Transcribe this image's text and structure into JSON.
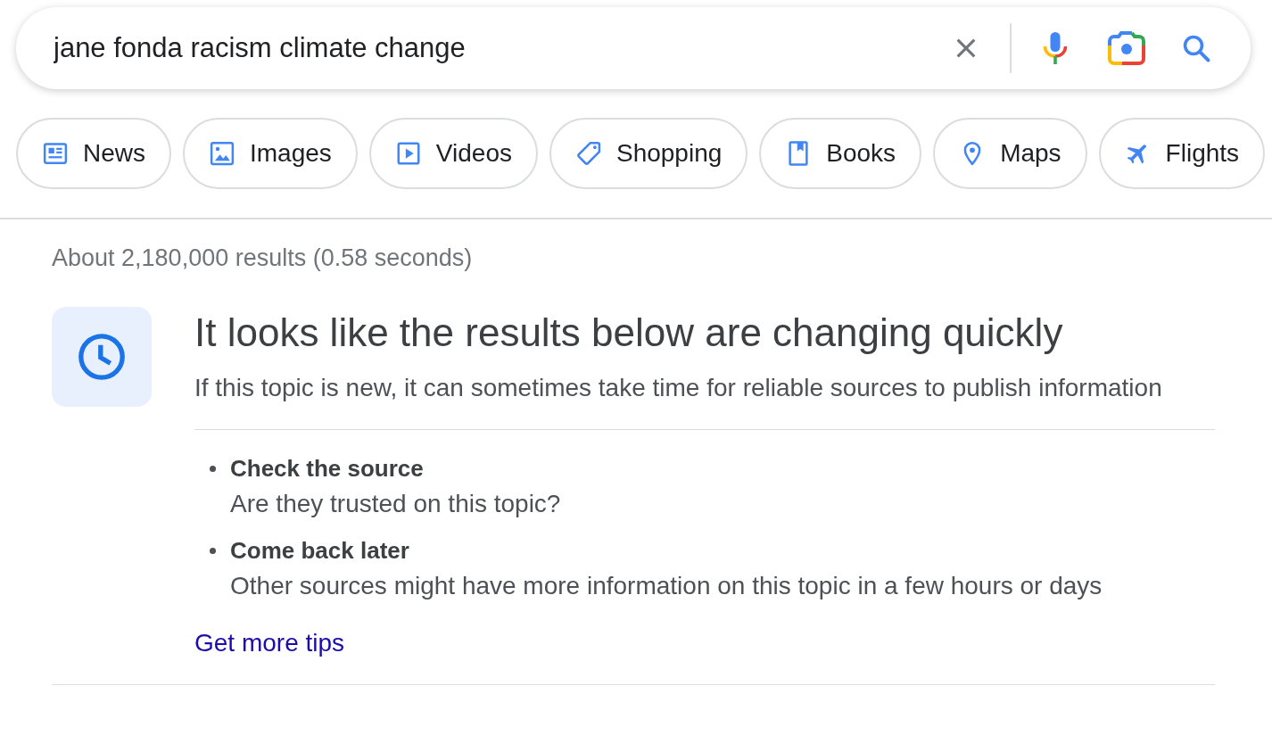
{
  "search": {
    "query": "jane fonda racism climate change"
  },
  "chips": [
    {
      "label": "News",
      "kind": "news"
    },
    {
      "label": "Images",
      "kind": "images"
    },
    {
      "label": "Videos",
      "kind": "videos"
    },
    {
      "label": "Shopping",
      "kind": "shopping"
    },
    {
      "label": "Books",
      "kind": "books"
    },
    {
      "label": "Maps",
      "kind": "maps"
    },
    {
      "label": "Flights",
      "kind": "flights"
    }
  ],
  "results_stats": "About 2,180,000 results (0.58 seconds)",
  "notice": {
    "title": "It looks like the results below are changing quickly",
    "subtitle": "If this topic is new, it can sometimes take time for reliable sources to publish information",
    "tips": [
      {
        "title": "Check the source",
        "text": "Are they trusted on this topic?"
      },
      {
        "title": "Come back later",
        "text": "Other sources might have more information on this topic in a few hours or days"
      }
    ],
    "link": "Get more tips"
  }
}
